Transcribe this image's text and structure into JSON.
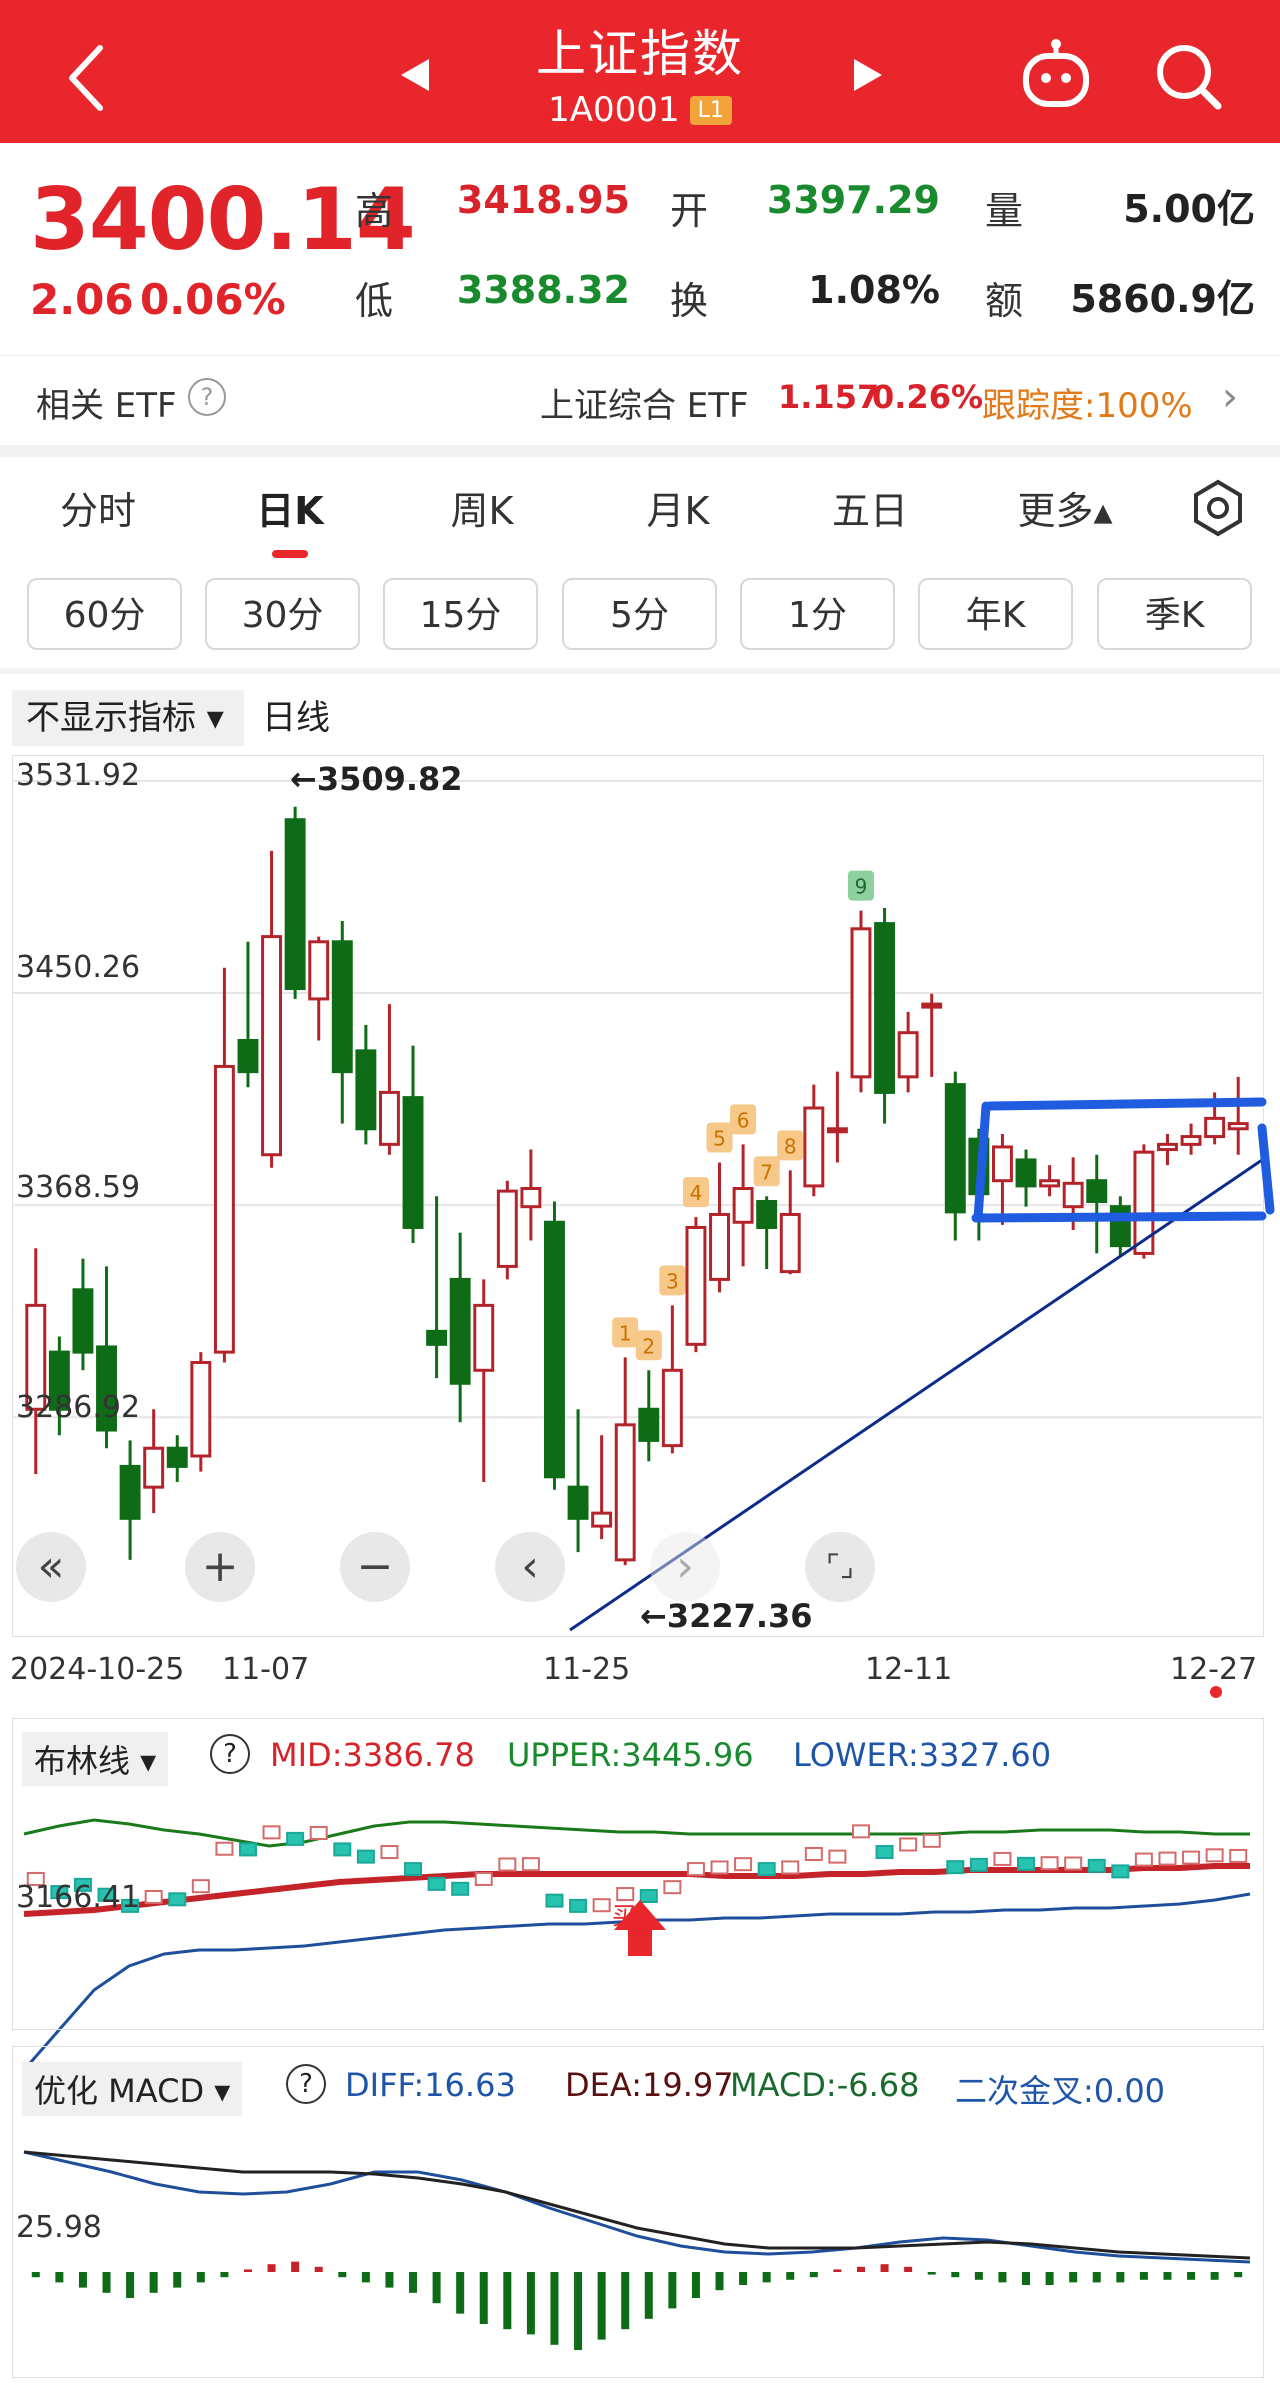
{
  "header": {
    "title": "上证指数",
    "code": "1A0001",
    "level_badge": "L1",
    "icons": [
      "back-icon",
      "prev-icon",
      "next-icon",
      "robot-icon",
      "search-icon"
    ]
  },
  "quote": {
    "price": "3400.14",
    "change": "2.06",
    "change_pct": "0.06%",
    "high_label": "高",
    "high": "3418.95",
    "open_label": "开",
    "open": "3397.29",
    "volume_label": "量",
    "volume": "5.00亿",
    "low_label": "低",
    "low": "3388.32",
    "turnover_label": "换",
    "turnover": "1.08%",
    "amount_label": "额",
    "amount": "5860.9亿"
  },
  "etf": {
    "label": "相关 ETF",
    "name": "上证综合 ETF",
    "price": "1.157",
    "pct": "0.26%",
    "tracking": "跟踪度:100%"
  },
  "tabs": [
    "分时",
    "日K",
    "周K",
    "月K",
    "五日",
    "更多▴"
  ],
  "active_tab": "日K",
  "period_pills": [
    "60分",
    "30分",
    "15分",
    "5分",
    "1分",
    "年K",
    "季K"
  ],
  "indicator_bar": {
    "selector": "不显示指标 ▾",
    "line_type": "日线"
  },
  "main_chart": {
    "y_labels": [
      "3531.92",
      "3450.26",
      "3368.59",
      "3286.92"
    ],
    "high_annotation": "←3509.82",
    "low_annotation": "←3227.36",
    "x_labels": [
      "2024-10-25",
      "11-07",
      "11-25",
      "12-11",
      "12-27"
    ],
    "td_labels": [
      "1",
      "2",
      "3",
      "4",
      "5",
      "6",
      "7",
      "8",
      "9"
    ],
    "controls": [
      "«",
      "+",
      "−",
      "‹",
      "›",
      "⌜⌟"
    ],
    "colors": {
      "up": "#b5232a",
      "down": "#0e6b16",
      "box": "#1f5ce0",
      "trend": "#0d2b8a"
    }
  },
  "boll": {
    "name": "布林线 ▾",
    "mid": "MID:3386.78",
    "upper": "UPPER:3445.96",
    "lower": "LOWER:3327.60",
    "y_label": "3166.41",
    "buy_label": "买"
  },
  "macd": {
    "name": "优化 MACD ▾",
    "diff": "DIFF:16.63",
    "dea": "DEA:19.97",
    "macd": "MACD:-6.68",
    "golden": "二次金叉:0.00",
    "y_label": "25.98"
  },
  "chart_data": {
    "type": "candlestick",
    "x_axis_labels": [
      "2024-10-25",
      "11-07",
      "11-25",
      "12-11",
      "12-27"
    ],
    "y_range": [
      3205,
      3540
    ],
    "candles": [
      [
        3290,
        3330,
        3265,
        3352
      ],
      [
        3312,
        3290,
        3280,
        3318
      ],
      [
        3336,
        3312,
        3305,
        3348
      ],
      [
        3314,
        3282,
        3275,
        3345
      ],
      [
        3268,
        3248,
        3232,
        3278
      ],
      [
        3260,
        3275,
        3250,
        3290
      ],
      [
        3275,
        3268,
        3262,
        3280
      ],
      [
        3272,
        3308,
        3266,
        3312
      ],
      [
        3312,
        3422,
        3308,
        3460
      ],
      [
        3432,
        3420,
        3414,
        3470
      ],
      [
        3388,
        3472,
        3383,
        3505
      ],
      [
        3517,
        3452,
        3448,
        3522
      ],
      [
        3448,
        3470,
        3432,
        3472
      ],
      [
        3470,
        3420,
        3400,
        3478
      ],
      [
        3428,
        3398,
        3392,
        3438
      ],
      [
        3392,
        3412,
        3388,
        3446
      ],
      [
        3410,
        3360,
        3354,
        3430
      ],
      [
        3320,
        3315,
        3302,
        3372
      ],
      [
        3340,
        3300,
        3285,
        3358
      ],
      [
        3305,
        3330,
        3262,
        3340
      ],
      [
        3345,
        3374,
        3340,
        3378
      ],
      [
        3368,
        3375,
        3355,
        3390
      ],
      [
        3362,
        3264,
        3259,
        3370
      ],
      [
        3260,
        3248,
        3235,
        3290
      ],
      [
        3245,
        3250,
        3240,
        3280
      ],
      [
        3232,
        3284,
        3230,
        3310
      ],
      [
        3290,
        3278,
        3270,
        3305
      ],
      [
        3276,
        3305,
        3273,
        3330
      ],
      [
        3315,
        3360,
        3312,
        3364
      ],
      [
        3340,
        3365,
        3335,
        3385
      ],
      [
        3362,
        3375,
        3345,
        3392
      ],
      [
        3370,
        3360,
        3344,
        3372
      ],
      [
        3343,
        3365,
        3342,
        3382
      ],
      [
        3376,
        3406,
        3372,
        3415
      ],
      [
        3398,
        3398,
        3385,
        3420
      ],
      [
        3418,
        3475,
        3412,
        3482
      ],
      [
        3477,
        3412,
        3400,
        3483
      ],
      [
        3418,
        3435,
        3412,
        3443
      ],
      [
        3445,
        3446,
        3418,
        3450
      ],
      [
        3415,
        3366,
        3355,
        3420
      ],
      [
        3394,
        3373,
        3355,
        3398
      ],
      [
        3378,
        3391,
        3361,
        3396
      ],
      [
        3386,
        3376,
        3368,
        3390
      ],
      [
        3376,
        3378,
        3372,
        3384
      ],
      [
        3368,
        3377,
        3359,
        3387
      ],
      [
        3378,
        3370,
        3350,
        3388
      ],
      [
        3368,
        3353,
        3349,
        3372
      ],
      [
        3350,
        3389,
        3348,
        3392
      ],
      [
        3390,
        3392,
        3384,
        3396
      ],
      [
        3392,
        3395,
        3388,
        3400
      ],
      [
        3395,
        3402,
        3392,
        3412
      ],
      [
        3398,
        3400,
        3388,
        3418
      ]
    ]
  }
}
